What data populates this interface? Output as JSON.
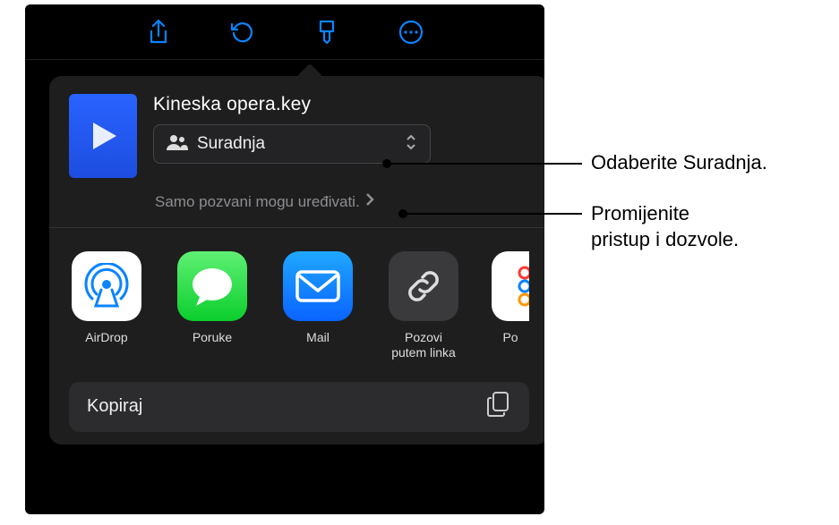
{
  "document": {
    "title": "Kineska opera.key"
  },
  "collab": {
    "label": "Suradnja"
  },
  "permissions": {
    "text": "Samo pozvani mogu uređivati."
  },
  "apps": {
    "airdrop": "AirDrop",
    "messages": "Poruke",
    "mail": "Mail",
    "invite_link_line1": "Pozovi",
    "invite_link_line2": "putem linka",
    "shortcuts_partial": "Po"
  },
  "actions": {
    "copy": "Kopiraj"
  },
  "callouts": {
    "collab": "Odaberite Suradnja.",
    "permissions_line1": "Promijenite",
    "permissions_line2": "pristup i dozvole."
  }
}
